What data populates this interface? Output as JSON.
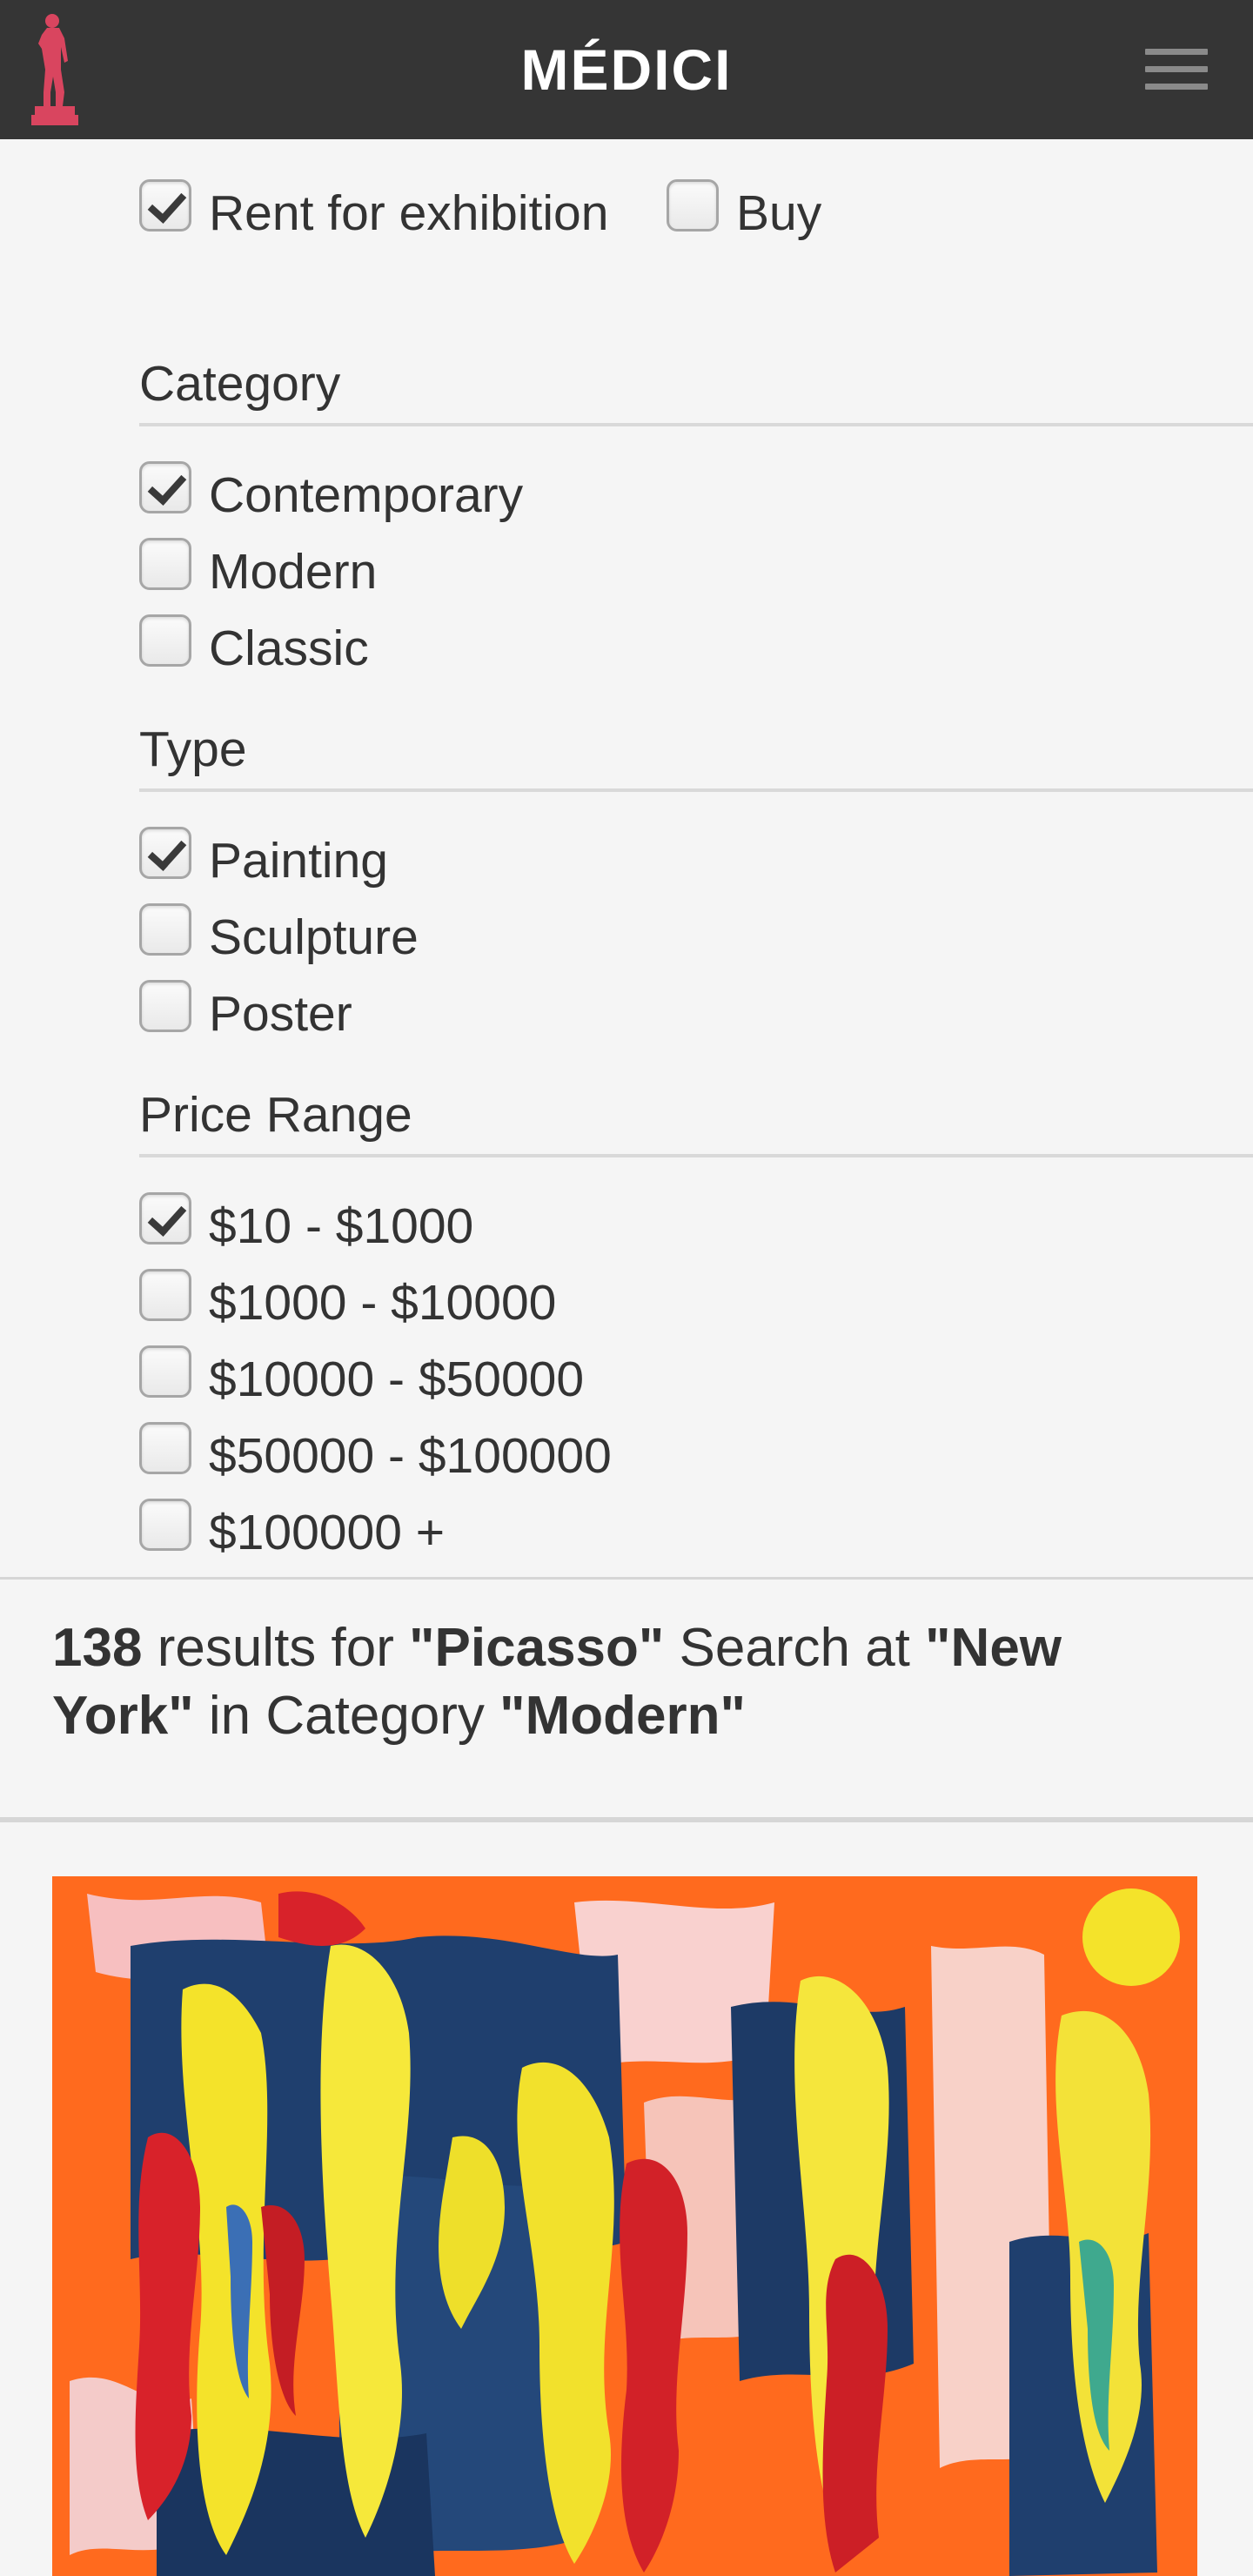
{
  "header": {
    "brand": "MÉDICI",
    "logo_icon": "statue-icon",
    "menu_icon": "hamburger-menu-icon",
    "background_color": "#353535",
    "logo_color": "#d9455f"
  },
  "listing": {
    "rent": {
      "label": "Rent for exhibition",
      "checked": true
    },
    "buy": {
      "label": "Buy",
      "checked": false
    }
  },
  "filters": {
    "category": {
      "title": "Category",
      "options": [
        {
          "label": "Contemporary",
          "checked": true
        },
        {
          "label": "Modern",
          "checked": false
        },
        {
          "label": "Classic",
          "checked": false
        }
      ]
    },
    "type": {
      "title": "Type",
      "options": [
        {
          "label": "Painting",
          "checked": true
        },
        {
          "label": "Sculpture",
          "checked": false
        },
        {
          "label": "Poster",
          "checked": false
        }
      ]
    },
    "price_range": {
      "title": "Price Range",
      "options": [
        {
          "label": "$10 - $1000",
          "checked": true
        },
        {
          "label": "$1000 - $10000",
          "checked": false
        },
        {
          "label": "$10000 - $50000",
          "checked": false
        },
        {
          "label": "$50000 - $100000",
          "checked": false
        },
        {
          "label": "$100000 +",
          "checked": false
        }
      ]
    }
  },
  "results": {
    "count": "138",
    "text_results_for": "results for",
    "query": "\"Picasso\"",
    "text_search_at": "Search at",
    "location": "\"New York\"",
    "text_in_category": "in Category",
    "category": "\"Modern\""
  },
  "artwork": {
    "image_icon": "abstract-painting-thumbnail",
    "dominant_colors": [
      "#ff6a1e",
      "#1f3f6e",
      "#f4e32a",
      "#d8222a",
      "#f3d6dc"
    ]
  }
}
